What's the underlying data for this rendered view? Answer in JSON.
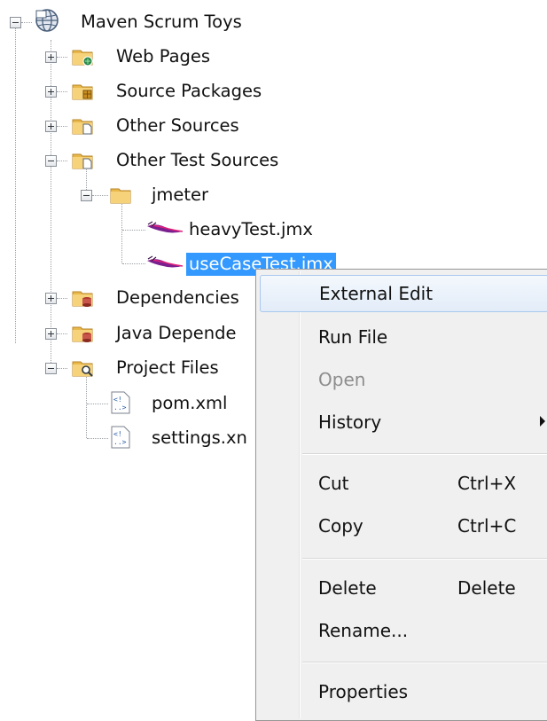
{
  "tree": {
    "root": {
      "label": "Maven Scrum Toys",
      "icon": "globe-project-icon",
      "expanded": true
    },
    "items": [
      {
        "label": "Web Pages",
        "icon": "folder-web-icon",
        "expanded": false
      },
      {
        "label": "Source Packages",
        "icon": "folder-package-icon",
        "expanded": false
      },
      {
        "label": "Other Sources",
        "icon": "folder-file-icon",
        "expanded": false
      },
      {
        "label": "Other Test Sources",
        "icon": "folder-file-icon",
        "expanded": true
      },
      {
        "label": "jmeter",
        "icon": "folder-icon",
        "expanded": true
      },
      {
        "label": "heavyTest.jmx",
        "icon": "jmeter-feather-icon"
      },
      {
        "label": "useCaseTest.jmx",
        "icon": "jmeter-feather-icon",
        "selected": true
      },
      {
        "label": "Dependencies",
        "icon": "folder-jar-icon",
        "expanded": false
      },
      {
        "label": "Java Depende",
        "icon": "folder-jar-icon",
        "expanded": false
      },
      {
        "label": "Project Files",
        "icon": "folder-search-icon",
        "expanded": true
      },
      {
        "label": "pom.xml",
        "icon": "xml-file-icon"
      },
      {
        "label": "settings.xn",
        "icon": "xml-file-icon"
      }
    ]
  },
  "context_menu": {
    "items": [
      {
        "label": "External Edit",
        "state": "hover"
      },
      {
        "label": "Run File"
      },
      {
        "label": "Open",
        "state": "disabled"
      },
      {
        "label": "History",
        "submenu": true
      },
      {
        "label": "Cut",
        "shortcut": "Ctrl+X"
      },
      {
        "label": "Copy",
        "shortcut": "Ctrl+C"
      },
      {
        "label": "Delete",
        "shortcut": "Delete"
      },
      {
        "label": "Rename..."
      },
      {
        "label": "Properties"
      }
    ]
  },
  "colors": {
    "selection": "#3399ff",
    "menu_background": "#f0f0f0",
    "menu_hover": "#e2ecf8",
    "disabled_text": "#8d8d8d"
  }
}
